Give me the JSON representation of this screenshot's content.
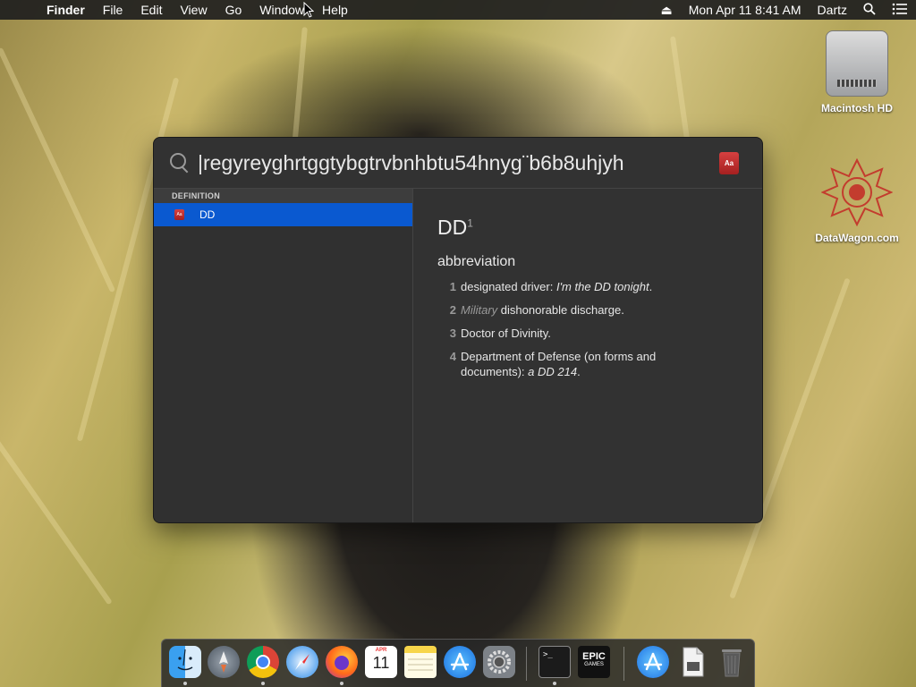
{
  "menubar": {
    "apple_glyph": "",
    "app_name": "Finder",
    "items": [
      "File",
      "Edit",
      "View",
      "Go",
      "Window",
      "Help"
    ],
    "eject_glyph": "⏏",
    "datetime": "Mon Apr 11  8:41 AM",
    "user": "Dartz"
  },
  "desktop": {
    "icons": [
      {
        "label": "Macintosh HD"
      },
      {
        "label": "DataWagon.com"
      }
    ]
  },
  "spotlight": {
    "query": "|regyreyghrtggtybgtrvbnhbtu54hnyg¨b6b8uhjyh",
    "dict_badge": "Aa",
    "section_header": "DEFINITION",
    "result_badge": "Aa",
    "result_label": "DD",
    "definition": {
      "word": "DD",
      "superscript": "1",
      "part_of_speech": "abbreviation",
      "senses": [
        {
          "num": "1",
          "pre": "designated driver: ",
          "label": "",
          "main": "",
          "example": "I'm the DD tonight",
          "post": "."
        },
        {
          "num": "2",
          "pre": "",
          "label": "Military",
          "main": " dishonorable discharge.",
          "example": "",
          "post": ""
        },
        {
          "num": "3",
          "pre": "Doctor of Divinity.",
          "label": "",
          "main": "",
          "example": "",
          "post": ""
        },
        {
          "num": "4",
          "pre": "Department of Defense (on forms and documents): ",
          "label": "",
          "main": "",
          "example": "a DD 214",
          "post": "."
        }
      ]
    }
  },
  "dock": {
    "calendar_month": "APR",
    "calendar_day": "11",
    "epic_top": "EPIC",
    "epic_bottom": "GAMES",
    "terminal_prompt": ">_"
  }
}
